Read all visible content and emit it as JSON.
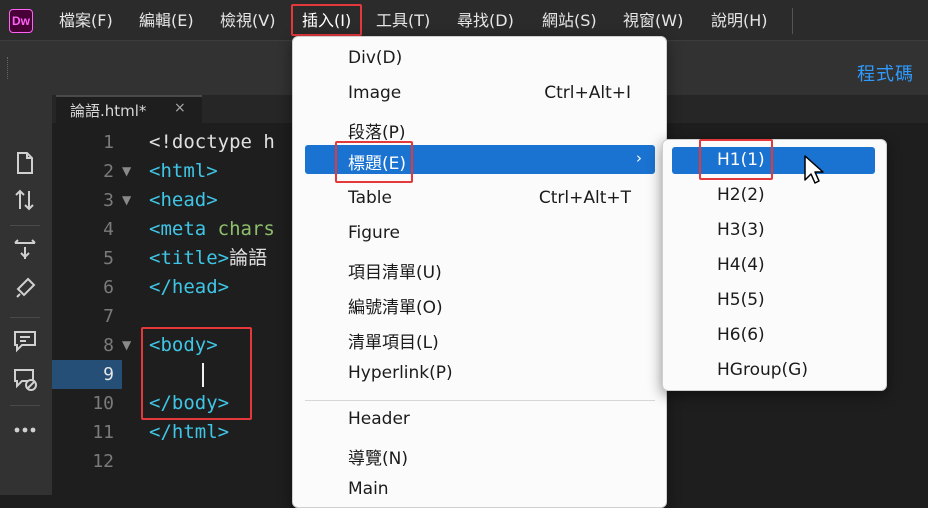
{
  "app": {
    "logo": "Dw"
  },
  "menubar": [
    {
      "label": "檔案(F)"
    },
    {
      "label": "編輯(E)"
    },
    {
      "label": "檢視(V)"
    },
    {
      "label": "插入(I)"
    },
    {
      "label": "工具(T)"
    },
    {
      "label": "尋找(D)"
    },
    {
      "label": "網站(S)"
    },
    {
      "label": "視窗(W)"
    },
    {
      "label": "說明(H)"
    }
  ],
  "toolbar": {
    "view_label": "程式碼"
  },
  "sidebar": {
    "icons": [
      "file-icon",
      "sort-arrows-icon",
      "expand-icon",
      "code-hint-icon",
      "comment-icon",
      "remove-comment-icon",
      "more-icon"
    ]
  },
  "tab": {
    "title": "論語.html*",
    "close": "×"
  },
  "editor": {
    "active_line": 9,
    "lines": [
      {
        "num": "1",
        "text": "<!doctype h"
      },
      {
        "num": "2",
        "text": "<html>"
      },
      {
        "num": "3",
        "text": "<head>"
      },
      {
        "num": "4",
        "tag": "<meta",
        "attr": " chars"
      },
      {
        "num": "5",
        "tag": "<title>",
        "text": "論語"
      },
      {
        "num": "6",
        "text": "</head>"
      },
      {
        "num": "7",
        "text": ""
      },
      {
        "num": "8",
        "text": "<body>"
      },
      {
        "num": "9",
        "text": ""
      },
      {
        "num": "10",
        "text": "</body>"
      },
      {
        "num": "11",
        "text": "</html>"
      },
      {
        "num": "12",
        "text": ""
      }
    ]
  },
  "insert_menu": {
    "items": [
      {
        "label": "Div(D)",
        "shortcut": ""
      },
      {
        "label": "Image",
        "shortcut": "Ctrl+Alt+I"
      },
      {
        "label": "段落(P)",
        "shortcut": ""
      },
      {
        "label": "標題(E)",
        "shortcut": "",
        "submenu_arrow": "›"
      },
      {
        "label": "Table",
        "shortcut": "Ctrl+Alt+T"
      },
      {
        "label": "Figure",
        "shortcut": ""
      },
      {
        "label": "項目清單(U)",
        "shortcut": ""
      },
      {
        "label": "編號清單(O)",
        "shortcut": ""
      },
      {
        "label": "清單項目(L)",
        "shortcut": ""
      },
      {
        "label": "Hyperlink(P)",
        "shortcut": ""
      },
      {
        "label": "Header",
        "shortcut": ""
      },
      {
        "label": "導覽(N)",
        "shortcut": ""
      },
      {
        "label": "Main",
        "shortcut": ""
      }
    ]
  },
  "heading_submenu": {
    "items": [
      "H1(1)",
      "H2(2)",
      "H3(3)",
      "H4(4)",
      "H5(5)",
      "H6(6)",
      "HGroup(G)"
    ]
  },
  "colors": {
    "accent": "#1a73d1",
    "highlight_box": "#e5383b",
    "tag": "#3fc6e6",
    "attr": "#8ec06c",
    "view_label": "#2f9bff"
  }
}
